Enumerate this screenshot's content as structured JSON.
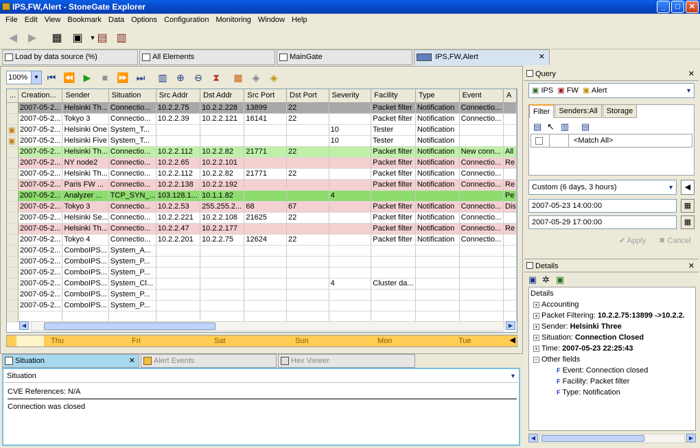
{
  "window": {
    "title": "IPS,FW,Alert - StoneGate Explorer"
  },
  "menu": [
    "File",
    "Edit",
    "View",
    "Bookmark",
    "Data",
    "Options",
    "Configuration",
    "Monitoring",
    "Window",
    "Help"
  ],
  "tabs": [
    {
      "label": "Load by data source (%)"
    },
    {
      "label": "All Elements"
    },
    {
      "label": "MainGate"
    },
    {
      "label": "IPS,FW,Alert"
    }
  ],
  "zoom": "100%",
  "table": {
    "columns": [
      "...",
      "Creation...",
      "Sender",
      "Situation",
      "Src Addr",
      "Dst Addr",
      "Src Port",
      "Dst Port",
      "Severity",
      "Facility",
      "Type",
      "Event",
      "A"
    ],
    "rows": [
      {
        "bg": "#a8a8a8",
        "alert": false,
        "cells": [
          "2007-05-2...",
          "Helsinki Th...",
          "Connectio...",
          "10.2.2.75",
          "10.2.2.228",
          "13899",
          "22",
          "",
          "Packet filter",
          "Notification",
          "Connectio...",
          ""
        ]
      },
      {
        "bg": "#ffffff",
        "alert": false,
        "cells": [
          "2007-05-2...",
          "Tokyo 3",
          "Connectio...",
          "10.2.2.39",
          "10.2.2.121",
          "16141",
          "22",
          "",
          "Packet filter",
          "Notification",
          "Connectio...",
          ""
        ]
      },
      {
        "bg": "#ffffff",
        "alert": true,
        "cells": [
          "2007-05-2...",
          "Helsinki One",
          "System_T...",
          "",
          "",
          "",
          "",
          "10",
          "Tester",
          "Notification",
          "",
          ""
        ]
      },
      {
        "bg": "#ffffff",
        "alert": true,
        "cells": [
          "2007-05-2...",
          "Helsinki Five",
          "System_T...",
          "",
          "",
          "",
          "",
          "10",
          "Tester",
          "Notification",
          "",
          ""
        ]
      },
      {
        "bg": "#bff0a8",
        "alert": false,
        "cells": [
          "2007-05-2...",
          "Helsinki Th...",
          "Connectio...",
          "10.2.2.112",
          "10.2.2.82",
          "21771",
          "22",
          "",
          "Packet filter",
          "Notification",
          "New conn...",
          "All"
        ]
      },
      {
        "bg": "#f4d0d0",
        "alert": false,
        "cells": [
          "2007-05-2...",
          "NY node2",
          "Connectio...",
          "10.2.2.65",
          "10.2.2.101",
          "",
          "",
          "",
          "Packet filter",
          "Notification",
          "Connectio...",
          "Re"
        ]
      },
      {
        "bg": "#ffffff",
        "alert": false,
        "cells": [
          "2007-05-2...",
          "Helsinki Th...",
          "Connectio...",
          "10.2.2.112",
          "10.2.2.82",
          "21771",
          "22",
          "",
          "Packet filter",
          "Notification",
          "Connectio...",
          ""
        ]
      },
      {
        "bg": "#f4d0d0",
        "alert": false,
        "cells": [
          "2007-05-2...",
          "Paris FW ...",
          "Connectio...",
          "10.2.2.138",
          "10.2.2.192",
          "",
          "",
          "",
          "Packet filter",
          "Notification",
          "Connectio...",
          "Re"
        ]
      },
      {
        "bg": "#8edc6e",
        "alert": false,
        "cells": [
          "2007-05-2...",
          "Analyzer ...",
          "TCP_SYN_...",
          "103.128.1...",
          "10.1.1.82",
          "",
          "",
          "4",
          "",
          "",
          "",
          "Pe"
        ]
      },
      {
        "bg": "#f4d0d0",
        "alert": false,
        "cells": [
          "2007-05-2...",
          "Tokyo 3",
          "Connectio...",
          "10.2.2.53",
          "255.255.2...",
          "68",
          "67",
          "",
          "Packet filter",
          "Notification",
          "Connectio...",
          "Dis"
        ]
      },
      {
        "bg": "#ffffff",
        "alert": false,
        "cells": [
          "2007-05-2...",
          "Helsinki Se...",
          "Connectio...",
          "10.2.2.221",
          "10.2.2.108",
          "21625",
          "22",
          "",
          "Packet filter",
          "Notification",
          "Connectio...",
          ""
        ]
      },
      {
        "bg": "#f4d0d0",
        "alert": false,
        "cells": [
          "2007-05-2...",
          "Helsinki Th...",
          "Connectio...",
          "10.2.2.47",
          "10.2.2.177",
          "",
          "",
          "",
          "Packet filter",
          "Notification",
          "Connectio...",
          "Re"
        ]
      },
      {
        "bg": "#ffffff",
        "alert": false,
        "cells": [
          "2007-05-2...",
          "Tokyo 4",
          "Connectio...",
          "10.2.2.201",
          "10.2.2.75",
          "12624",
          "22",
          "",
          "Packet filter",
          "Notification",
          "Connectio...",
          ""
        ]
      },
      {
        "bg": "#ffffff",
        "alert": false,
        "cells": [
          "2007-05-2...",
          "ComboIPS...",
          "System_A...",
          "",
          "",
          "",
          "",
          "",
          "",
          "",
          "",
          ""
        ]
      },
      {
        "bg": "#ffffff",
        "alert": false,
        "cells": [
          "2007-05-2...",
          "ComboIPS...",
          "System_P...",
          "",
          "",
          "",
          "",
          "",
          "",
          "",
          "",
          ""
        ]
      },
      {
        "bg": "#ffffff",
        "alert": false,
        "cells": [
          "2007-05-2...",
          "ComboIPS...",
          "System_P...",
          "",
          "",
          "",
          "",
          "",
          "",
          "",
          "",
          ""
        ]
      },
      {
        "bg": "#ffffff",
        "alert": false,
        "cells": [
          "2007-05-2...",
          "ComboIPS...",
          "System_Cl...",
          "",
          "",
          "",
          "",
          "4",
          "Cluster da...",
          "",
          "",
          ""
        ]
      },
      {
        "bg": "#ffffff",
        "alert": false,
        "cells": [
          "2007-05-2...",
          "ComboIPS...",
          "System_P...",
          "",
          "",
          "",
          "",
          "",
          "",
          "",
          "",
          ""
        ]
      },
      {
        "bg": "#ffffff",
        "alert": false,
        "cells": [
          "2007-05-2...",
          "ComboIPS...",
          "System_P...",
          "",
          "",
          "",
          "",
          "",
          "",
          "",
          "",
          ""
        ]
      }
    ]
  },
  "timeline": [
    "Thu",
    "Fri",
    "Sat",
    "Sun",
    "Mon",
    "Tue"
  ],
  "bottom_tabs": [
    {
      "label": "Situation"
    },
    {
      "label": "Alert Events"
    },
    {
      "label": "Hex Viewer"
    }
  ],
  "situation": {
    "select": "Situation",
    "cve": "CVE References: N/A",
    "description": "Connection was closed"
  },
  "query": {
    "title": "Query",
    "sources": [
      "IPS",
      "FW",
      "Alert"
    ],
    "tabs": [
      "Filter",
      "Senders:All",
      "Storage"
    ],
    "filter_item": "<Match All>",
    "range": "Custom (6 days, 3 hours)",
    "start": "2007-05-23 14:00:00",
    "end": "2007-05-29 17:00:00",
    "apply": "Apply",
    "cancel": "Cancel"
  },
  "details": {
    "title": "Details",
    "root": "Details",
    "items": [
      {
        "label": "Accounting",
        "value": ""
      },
      {
        "label": "Packet Filtering: ",
        "value": "10.2.2.75:13899 ->10.2.2."
      },
      {
        "label": "Sender: ",
        "value": "Helsinki Three"
      },
      {
        "label": "Situation: ",
        "value": "Connection Closed"
      },
      {
        "label": "Time: ",
        "value": "2007-05-23 22:25:43"
      }
    ],
    "other_fields": "Other fields",
    "fields": [
      "Event: Connection closed",
      "Facility: Packet filter",
      "Type: Notification"
    ]
  }
}
